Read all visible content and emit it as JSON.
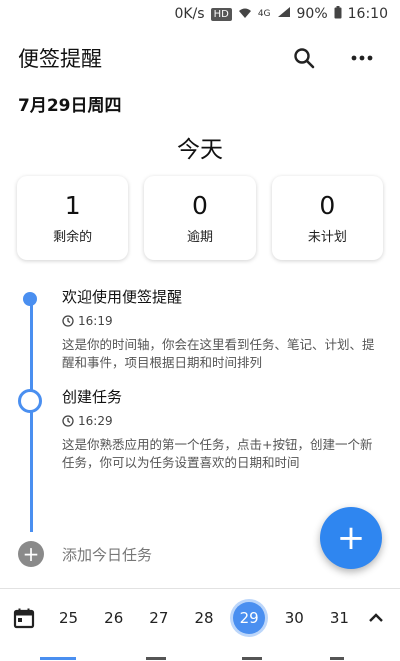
{
  "status_bar": {
    "speed": "0K/s",
    "hd": "HD",
    "network": "4G",
    "battery": "90%",
    "time": "16:10"
  },
  "app_bar": {
    "title": "便签提醒",
    "icons": [
      "search-icon",
      "more-icon"
    ]
  },
  "date_header": "7月29日周四",
  "today_label": "今天",
  "stats": [
    {
      "value": "1",
      "label": "剩余的"
    },
    {
      "value": "0",
      "label": "逾期"
    },
    {
      "value": "0",
      "label": "未计划"
    }
  ],
  "timeline": [
    {
      "title": "欢迎使用便签提醒",
      "time": "16:19",
      "desc": "这是你的时间轴，你会在这里看到任务、笔记、计划、提醒和事件，项目根据日期和时间排列"
    },
    {
      "title": "创建任务",
      "time": "16:29",
      "desc": "这是你熟悉应用的第一个任务，点击+按钮，创建一个新任务，你可以为任务设置喜欢的日期和时间"
    }
  ],
  "add_today": "添加今日任务",
  "fab_label": "+",
  "week": {
    "days": [
      "25",
      "26",
      "27",
      "28",
      "29",
      "30",
      "31"
    ],
    "selected": "29"
  },
  "colors": {
    "accent": "#4a8ff0",
    "fab": "#2f86f0"
  }
}
